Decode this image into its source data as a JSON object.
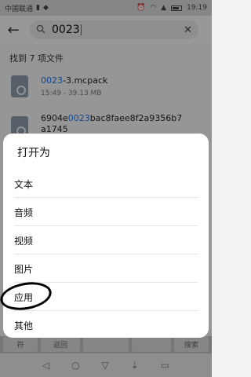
{
  "status_bar": {
    "carrier": "中国联通",
    "time": "19:19"
  },
  "search": {
    "query": "0023"
  },
  "results": {
    "summary": "找到 7 项文件",
    "files": [
      {
        "name_highlight": "0023",
        "name_rest": "-3.mcpack",
        "meta": "15:49 - 39.13 MB"
      },
      {
        "name_prefix": "6904e",
        "name_highlight": "0023",
        "name_rest": "bac8faee8f2a9356b7",
        "name_line2": "a1745"
      }
    ]
  },
  "dialog": {
    "title": "打开为",
    "options": [
      "文本",
      "音频",
      "视频",
      "图片",
      "应用",
      "其他"
    ]
  },
  "keyboard": {
    "keys": [
      "符",
      "返回",
      "搜索"
    ]
  },
  "icons": {
    "back": "back-arrow-icon",
    "search": "search-icon",
    "clear": "close-icon",
    "nav": [
      "nav-back-icon",
      "nav-home-icon",
      "nav-recents-icon",
      "keyboard-hide-icon",
      "keyboard-switch-icon"
    ]
  },
  "colors": {
    "highlight": "#1a73e8"
  }
}
